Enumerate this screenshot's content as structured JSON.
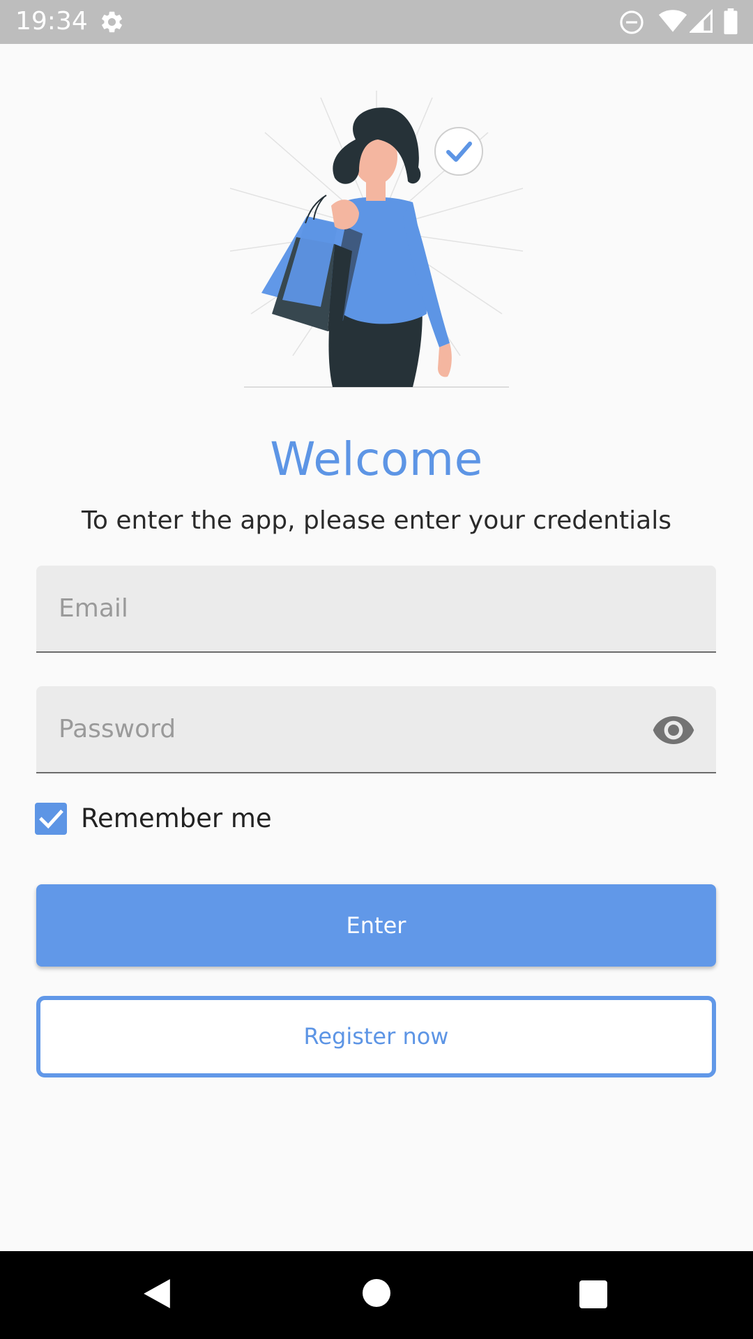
{
  "status_bar": {
    "time": "19:34",
    "icons": [
      "settings-gear-icon",
      "do-not-disturb-icon",
      "wifi-icon",
      "cell-signal-icon",
      "battery-icon"
    ]
  },
  "login": {
    "title": "Welcome",
    "subtitle": "To enter the app, please enter your credentials",
    "email_placeholder": "Email",
    "email_value": "",
    "password_placeholder": "Password",
    "password_value": "",
    "remember_label": "Remember me",
    "remember_checked": true,
    "enter_label": "Enter",
    "register_label": "Register now"
  },
  "nav_bar": {
    "icons": [
      "back-triangle-icon",
      "home-circle-icon",
      "recents-square-icon"
    ]
  },
  "colors": {
    "accent": "#6198e8",
    "status_bar": "#bdbdbd",
    "field_bg": "#ebebeb",
    "background": "#fafafa"
  }
}
